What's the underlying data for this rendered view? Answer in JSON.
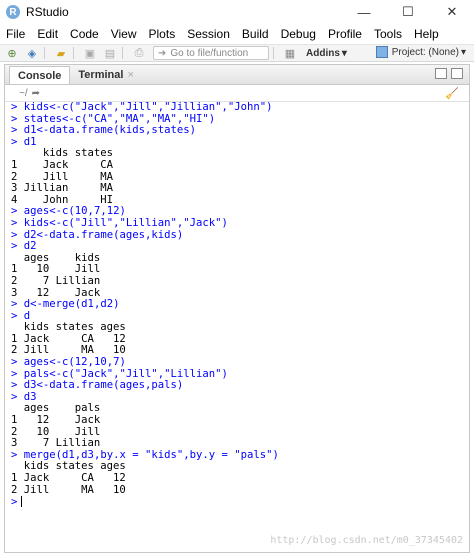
{
  "window": {
    "title": "RStudio",
    "app_icon": "R",
    "controls": [
      "—",
      "☐",
      "✕"
    ]
  },
  "menu": [
    "File",
    "Edit",
    "Code",
    "View",
    "Plots",
    "Session",
    "Build",
    "Debug",
    "Profile",
    "Tools",
    "Help"
  ],
  "toolbar": {
    "goto_placeholder": "Go to file/function",
    "addins_label": "Addins",
    "project_label": "Project: (None)"
  },
  "tabs": {
    "console": "Console",
    "terminal": "Terminal",
    "terminal_close": "×"
  },
  "console": {
    "path": "~/",
    "lines": [
      {
        "prompt": true,
        "text": "kids<-c(\"Jack\",\"Jill\",\"Jillian\",\"John\")"
      },
      {
        "prompt": true,
        "text": "states<-c(\"CA\",\"MA\",\"MA\",\"HI\")"
      },
      {
        "prompt": true,
        "text": "d1<-data.frame(kids,states)"
      },
      {
        "prompt": true,
        "text": "d1"
      },
      {
        "prompt": false,
        "text": "     kids states"
      },
      {
        "prompt": false,
        "text": "1    Jack     CA"
      },
      {
        "prompt": false,
        "text": "2    Jill     MA"
      },
      {
        "prompt": false,
        "text": "3 Jillian     MA"
      },
      {
        "prompt": false,
        "text": "4    John     HI"
      },
      {
        "prompt": true,
        "text": "ages<-c(10,7,12)"
      },
      {
        "prompt": true,
        "text": "kids<-c(\"Jill\",\"Lillian\",\"Jack\")"
      },
      {
        "prompt": true,
        "text": "d2<-data.frame(ages,kids)"
      },
      {
        "prompt": true,
        "text": "d2"
      },
      {
        "prompt": false,
        "text": "  ages    kids"
      },
      {
        "prompt": false,
        "text": "1   10    Jill"
      },
      {
        "prompt": false,
        "text": "2    7 Lillian"
      },
      {
        "prompt": false,
        "text": "3   12    Jack"
      },
      {
        "prompt": true,
        "text": "d<-merge(d1,d2)"
      },
      {
        "prompt": true,
        "text": "d"
      },
      {
        "prompt": false,
        "text": "  kids states ages"
      },
      {
        "prompt": false,
        "text": "1 Jack     CA   12"
      },
      {
        "prompt": false,
        "text": "2 Jill     MA   10"
      },
      {
        "prompt": true,
        "text": "ages<-c(12,10,7)"
      },
      {
        "prompt": true,
        "text": "pals<-c(\"Jack\",\"Jill\",\"Lillian\")"
      },
      {
        "prompt": true,
        "text": "d3<-data.frame(ages,pals)"
      },
      {
        "prompt": true,
        "text": "d3"
      },
      {
        "prompt": false,
        "text": "  ages    pals"
      },
      {
        "prompt": false,
        "text": "1   12    Jack"
      },
      {
        "prompt": false,
        "text": "2   10    Jill"
      },
      {
        "prompt": false,
        "text": "3    7 Lillian"
      },
      {
        "prompt": true,
        "text": "merge(d1,d3,by.x = \"kids\",by.y = \"pals\")"
      },
      {
        "prompt": false,
        "text": "  kids states ages"
      },
      {
        "prompt": false,
        "text": "1 Jack     CA   12"
      },
      {
        "prompt": false,
        "text": "2 Jill     MA   10"
      }
    ],
    "prompt_char": ">"
  },
  "watermark": "http://blog.csdn.net/m0_37345402",
  "colors": {
    "command": "#0000ff",
    "output": "#000000",
    "accent": "#75aadb"
  }
}
